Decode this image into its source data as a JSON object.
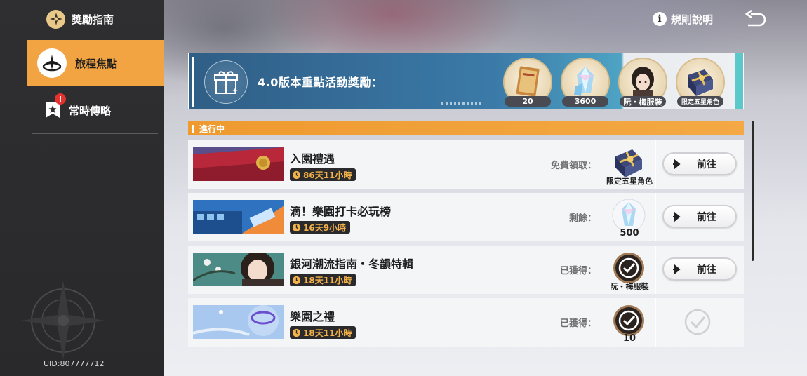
{
  "sidebar": {
    "title": "獎勵指南",
    "items": [
      {
        "label": "旅程焦點",
        "active": true
      },
      {
        "label": "常時傳略",
        "active": false,
        "badge": "!"
      }
    ],
    "uid": "UID:807777712"
  },
  "header": {
    "rules_label": "規則說明",
    "back_icon": "back-arrow-icon"
  },
  "banner": {
    "title": "4.0版本重點活動獎勵：",
    "rewards": [
      {
        "icon": "ticket-icon",
        "label": "20"
      },
      {
        "icon": "crystal-icon",
        "label": "3600"
      },
      {
        "icon": "character-outfit-icon",
        "label": "阮・梅服裝"
      },
      {
        "icon": "gift-box-icon",
        "label": "限定五星角色"
      }
    ]
  },
  "section": {
    "title": "進行中"
  },
  "tasks": [
    {
      "title": "入園禮遇",
      "timer": "86天11小時",
      "status": "免費領取：",
      "item_caption": "限定五星角色",
      "item_icon": "gift-box-icon",
      "action": "前往",
      "done": false
    },
    {
      "title": "滴！樂園打卡必玩榜",
      "timer": "16天9小時",
      "status": "剩餘：",
      "item_caption": "500",
      "item_icon": "crystal-icon",
      "action": "前往",
      "done": false
    },
    {
      "title": "銀河潮流指南・冬韻特輯",
      "timer": "18天11小時",
      "status": "已獲得：",
      "item_caption": "阮・梅服裝",
      "item_icon": "check-icon",
      "action": "前往",
      "done": false
    },
    {
      "title": "樂園之禮",
      "timer": "18天11小時",
      "status": "已獲得：",
      "item_caption": "10",
      "item_icon": "check-icon",
      "action": "",
      "done": true
    }
  ],
  "colors": {
    "accent": "#f2a443",
    "sidebar_bg": "#2f2f31",
    "timer_text": "#f3b24a"
  }
}
